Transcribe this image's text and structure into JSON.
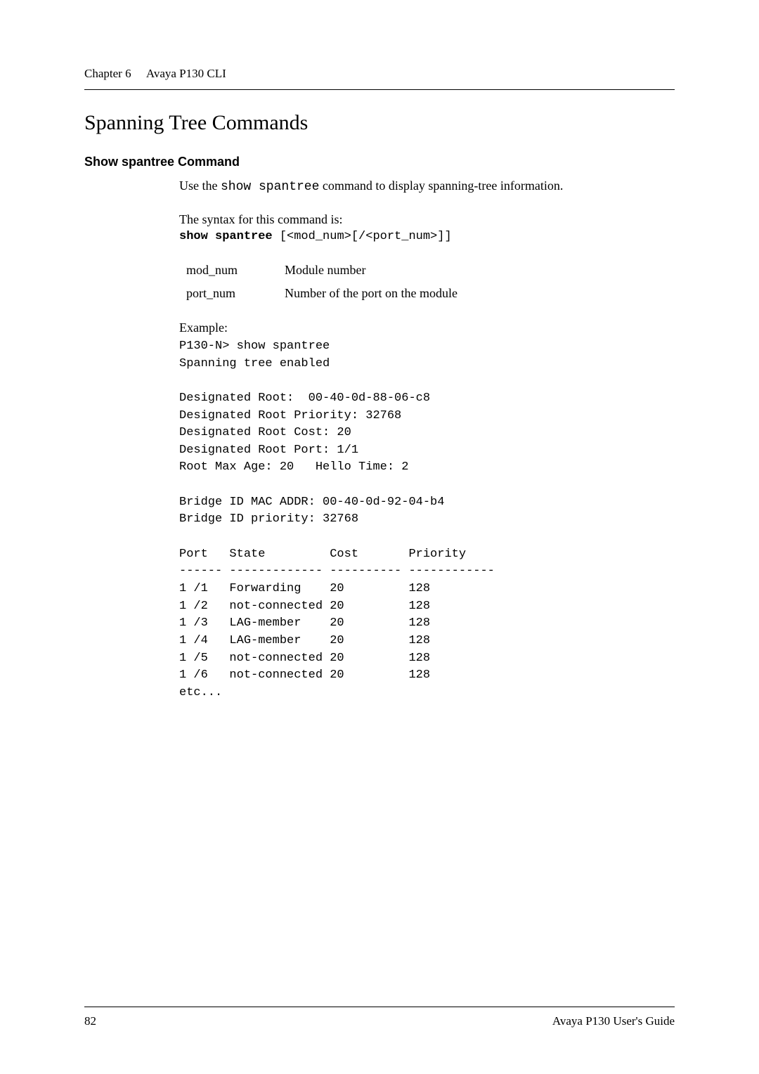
{
  "header": {
    "chapter": "Chapter 6",
    "title": "Avaya P130 CLI"
  },
  "section": {
    "title": "Spanning Tree Commands"
  },
  "command": {
    "heading": "Show spantree Command",
    "description_prefix": "Use the ",
    "description_code": "show spantree",
    "description_suffix": " command to display spanning-tree information.",
    "syntax_label": "The syntax for this command is:",
    "syntax_bold": "show spantree",
    "syntax_args": " [<mod_num>[/<port_num>]]",
    "params": [
      {
        "name": "mod_num",
        "desc": "Module number"
      },
      {
        "name": "port_num",
        "desc": "Number of the port on the module"
      }
    ],
    "example_label": "Example:",
    "example_code": "P130-N> show spantree\nSpanning tree enabled\n\nDesignated Root:  00-40-0d-88-06-c8\nDesignated Root Priority: 32768\nDesignated Root Cost: 20\nDesignated Root Port: 1/1\nRoot Max Age: 20   Hello Time: 2\n\nBridge ID MAC ADDR: 00-40-0d-92-04-b4\nBridge ID priority: 32768\n\nPort   State         Cost       Priority\n------ ------------- ---------- ------------\n1 /1   Forwarding    20         128\n1 /2   not-connected 20         128\n1 /3   LAG-member    20         128\n1 /4   LAG-member    20         128\n1 /5   not-connected 20         128\n1 /6   not-connected 20         128\netc..."
  },
  "footer": {
    "page": "82",
    "guide": "Avaya P130 User's Guide"
  }
}
